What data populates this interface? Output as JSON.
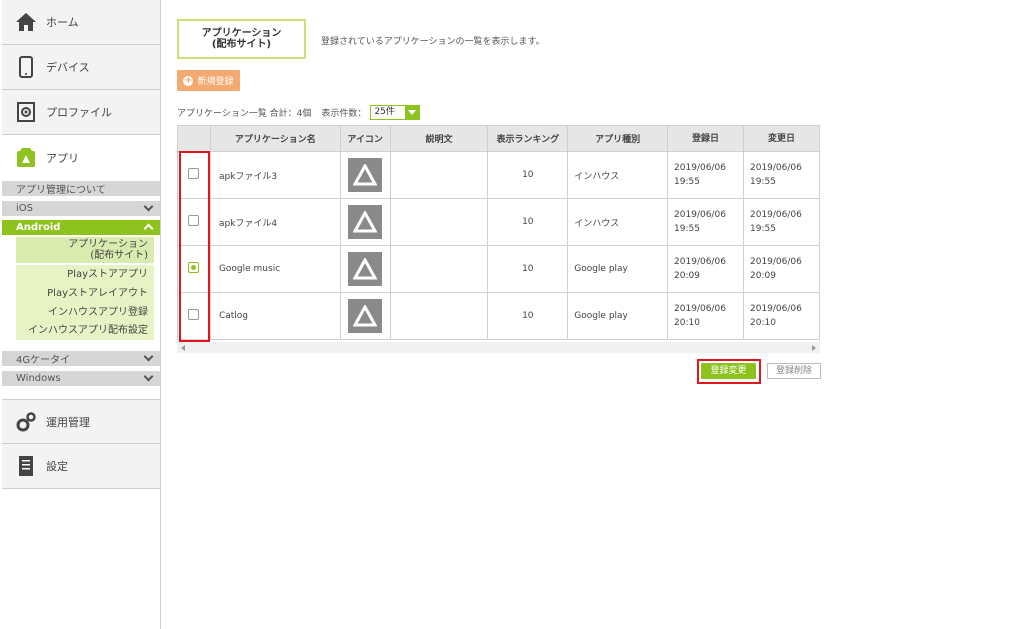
{
  "sidebar": {
    "home": "ホーム",
    "device": "デバイス",
    "profile": "プロファイル",
    "app": "アプリ",
    "app_about": "アプリ管理について",
    "ios": "iOS",
    "android": "Android",
    "android_items": [
      "アプリケーション\n(配布サイト)",
      "Playストアアプリ",
      "Playストアレイアウト",
      "インハウスアプリ登録",
      "インハウスアプリ配布設定"
    ],
    "keitai": "4Gケータイ",
    "windows": "Windows",
    "ops": "運用管理",
    "settings": "設定"
  },
  "main": {
    "tab_line1": "アプリケーション",
    "tab_line2": "(配布サイト)",
    "description": "登録されているアプリケーションの一覧を表示します。",
    "new_button": "新規登録",
    "list_summary": "アプリケーション一覧 合計：4個",
    "per_page_label": "表示件数：",
    "per_page_value": "25件",
    "columns": [
      "アプリケーション名",
      "アイコン",
      "説明文",
      "表示ランキング",
      "アプリ種別",
      "登録日",
      "変更日"
    ],
    "rows": [
      {
        "name": "apkファイル3",
        "desc": "",
        "rank": "10",
        "type": "インハウス",
        "reg1": "2019/06/06",
        "reg2": "19:55",
        "mod1": "2019/06/06",
        "mod2": "19:55",
        "checked": false
      },
      {
        "name": "apkファイル4",
        "desc": "",
        "rank": "10",
        "type": "インハウス",
        "reg1": "2019/06/06",
        "reg2": "19:55",
        "mod1": "2019/06/06",
        "mod2": "19:55",
        "checked": false
      },
      {
        "name": "Google music",
        "desc": "",
        "rank": "10",
        "type": "Google play",
        "reg1": "2019/06/06",
        "reg2": "20:09",
        "mod1": "2019/06/06",
        "mod2": "20:09",
        "checked": true
      },
      {
        "name": "Catlog",
        "desc": "",
        "rank": "10",
        "type": "Google play",
        "reg1": "2019/06/06",
        "reg2": "20:10",
        "mod1": "2019/06/06",
        "mod2": "20:10",
        "checked": false
      }
    ],
    "update_button": "登録変更",
    "delete_button": "登録削除"
  },
  "colors": {
    "accent_green": "#8dc21f",
    "orange": "#f3a970",
    "highlight_red": "#e0161e"
  }
}
